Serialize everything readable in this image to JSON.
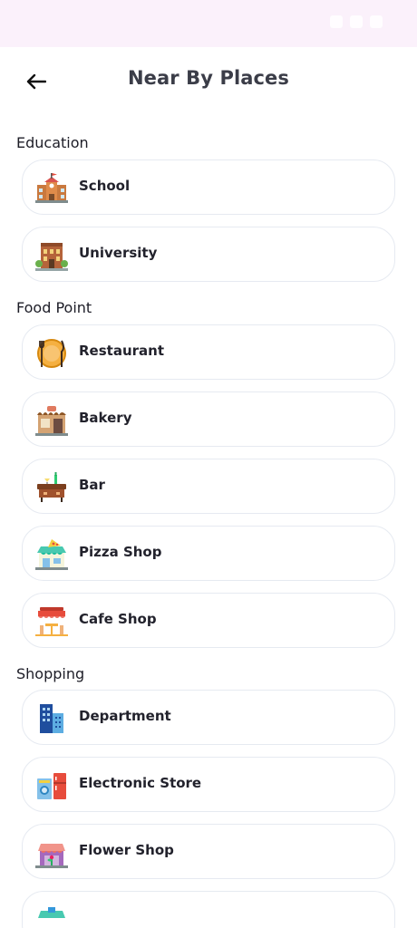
{
  "header": {
    "title": "Near By Places"
  },
  "sections": [
    {
      "title": "Education",
      "items": [
        {
          "label": "School",
          "icon": "school-icon"
        },
        {
          "label": "University",
          "icon": "university-icon"
        }
      ]
    },
    {
      "title": "Food Point",
      "items": [
        {
          "label": "Restaurant",
          "icon": "restaurant-icon"
        },
        {
          "label": "Bakery",
          "icon": "bakery-icon"
        },
        {
          "label": "Bar",
          "icon": "bar-icon"
        },
        {
          "label": "Pizza Shop",
          "icon": "pizza-shop-icon"
        },
        {
          "label": "Cafe Shop",
          "icon": "cafe-shop-icon"
        }
      ]
    },
    {
      "title": "Shopping",
      "items": [
        {
          "label": "Department",
          "icon": "department-icon"
        },
        {
          "label": "Electronic Store",
          "icon": "electronic-store-icon"
        },
        {
          "label": "Flower Shop",
          "icon": "flower-shop-icon"
        }
      ]
    }
  ]
}
